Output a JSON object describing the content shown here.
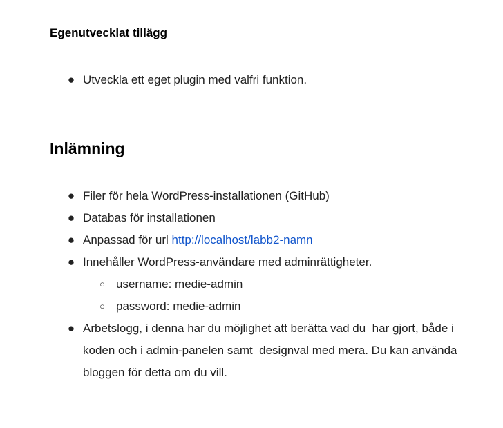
{
  "section1": {
    "heading": "Egenutvecklat tillägg",
    "items": [
      "Utveckla ett eget plugin med valfri funktion."
    ]
  },
  "section2": {
    "heading": "Inlämning",
    "items": {
      "files": "Filer för hela WordPress-installationen  (GitHub)",
      "database": "Databas för installationen",
      "url_prefix": "Anpassad för url ",
      "url_link": "http://localhost/labb2-namn",
      "users": "Innehåller WordPress-användare med adminrättigheter.",
      "username": "username: medie-admin",
      "password": "password: medie-admin",
      "worklog": "Arbetslogg, i denna har du möjlighet att berätta vad du  har gjort, både i koden och i admin-panelen samt  designval med mera. Du kan använda bloggen för detta om du vill."
    }
  },
  "bullets": {
    "disc": "●",
    "circle": "○"
  },
  "colors": {
    "text": "#222222",
    "link": "#1155cc"
  }
}
